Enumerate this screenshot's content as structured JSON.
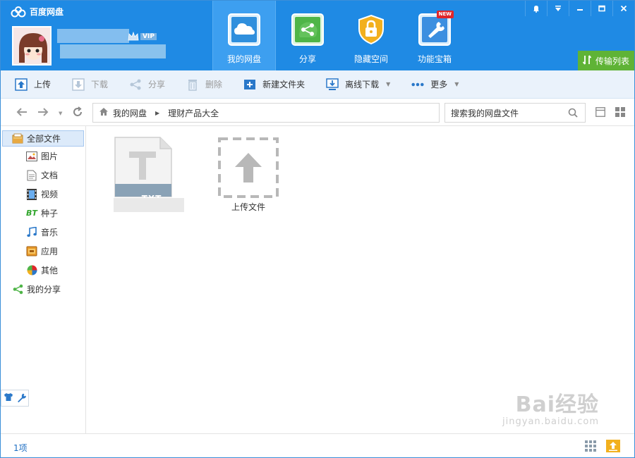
{
  "app": {
    "title": "百度网盘",
    "vip_label": "VIP"
  },
  "nav": {
    "items": [
      {
        "label": "我的网盘",
        "icon": "cloud-icon",
        "active": true
      },
      {
        "label": "分享",
        "icon": "share-icon",
        "active": false
      },
      {
        "label": "隐藏空间",
        "icon": "lock-icon",
        "active": false
      },
      {
        "label": "功能宝箱",
        "icon": "toolbox-icon",
        "active": false,
        "badge": "NEW"
      }
    ]
  },
  "window_controls": {
    "icons": [
      "bell-icon",
      "menu-icon",
      "minimize-icon",
      "maximize-icon",
      "close-icon"
    ]
  },
  "transfer_button": {
    "label": "传输列表"
  },
  "toolbar": {
    "upload": "上传",
    "download": "下载",
    "share": "分享",
    "delete": "删除",
    "new_folder": "新建文件夹",
    "offline_download": "离线下载",
    "more": "更多"
  },
  "address": {
    "crumbs": [
      "我的网盘",
      "理财产品大全"
    ],
    "search_placeholder": "搜索我的网盘文件"
  },
  "sidebar": {
    "all_files": "全部文件",
    "items": [
      {
        "label": "图片",
        "icon": "image-icon"
      },
      {
        "label": "文档",
        "icon": "document-icon"
      },
      {
        "label": "视频",
        "icon": "video-icon"
      },
      {
        "label": "种子",
        "icon": "bt-icon"
      },
      {
        "label": "音乐",
        "icon": "music-icon"
      },
      {
        "label": "应用",
        "icon": "app-icon"
      },
      {
        "label": "其他",
        "icon": "other-icon"
      }
    ],
    "my_share": "我的分享"
  },
  "content": {
    "file_type_label": "TXT",
    "upload_tile_label": "上传文件"
  },
  "status": {
    "count": "1项"
  },
  "watermark": {
    "main": "Bai经验",
    "sub": "jingyan.baidu.com"
  },
  "colors": {
    "header": "#1f8ae4",
    "accent_green": "#5fb336",
    "toolbar_bg": "#eaf2fb"
  }
}
